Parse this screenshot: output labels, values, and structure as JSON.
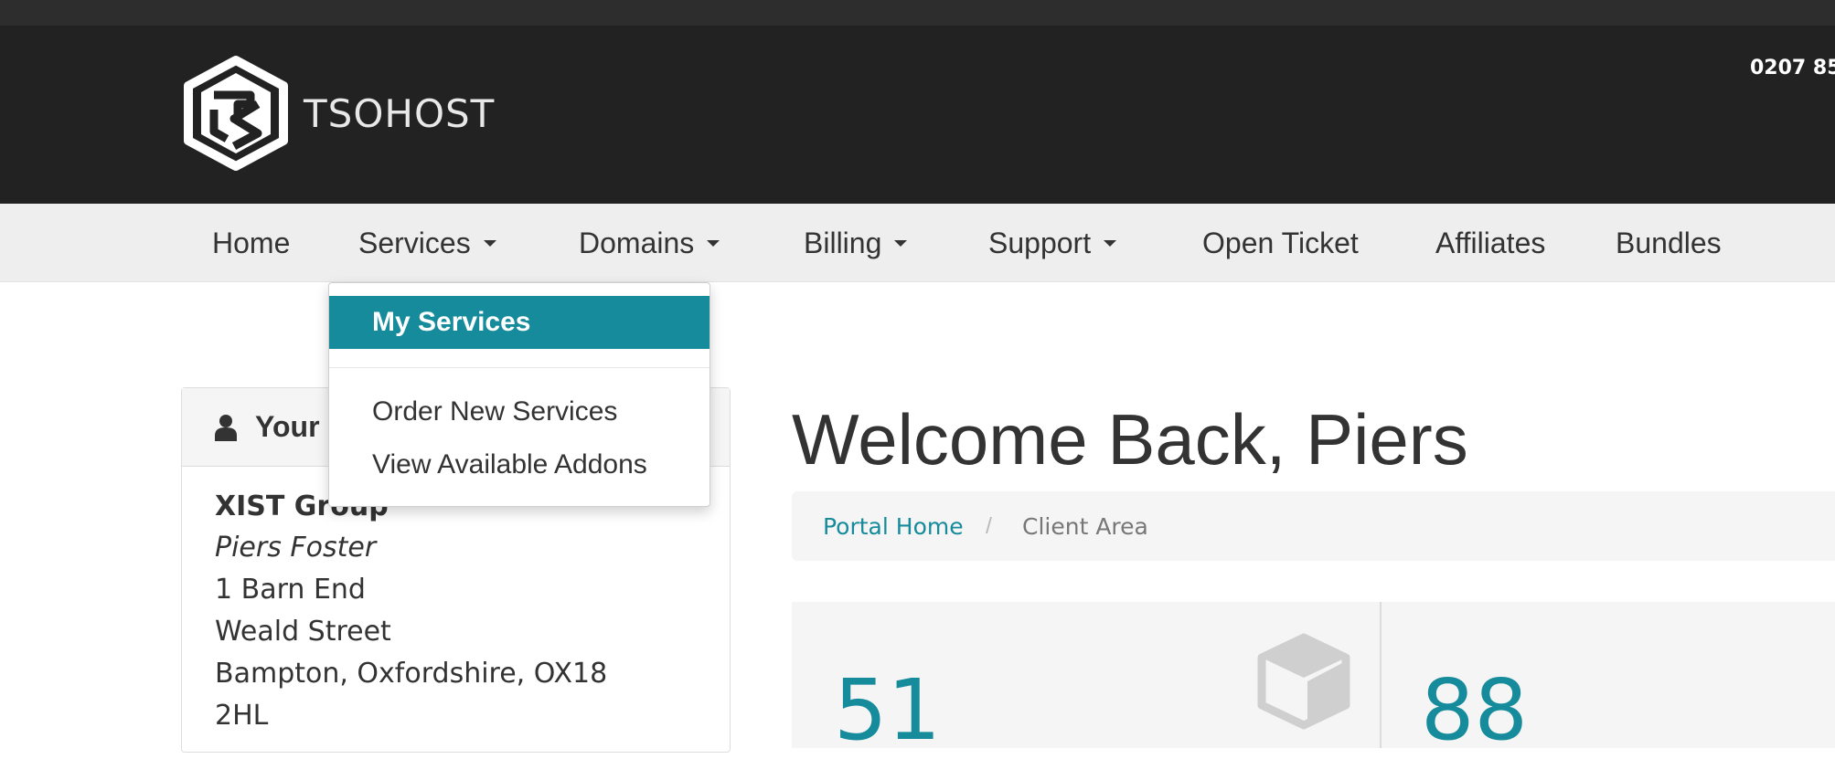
{
  "brand": {
    "name": "TSOHOST",
    "phone": "0207 85"
  },
  "nav": {
    "items": [
      {
        "label": "Home",
        "has_dropdown": false
      },
      {
        "label": "Services",
        "has_dropdown": true
      },
      {
        "label": "Domains",
        "has_dropdown": true
      },
      {
        "label": "Billing",
        "has_dropdown": true
      },
      {
        "label": "Support",
        "has_dropdown": true
      },
      {
        "label": "Open Ticket",
        "has_dropdown": false
      },
      {
        "label": "Affiliates",
        "has_dropdown": false
      },
      {
        "label": "Bundles",
        "has_dropdown": false
      }
    ]
  },
  "services_dropdown": {
    "active": "My Services",
    "items": [
      "Order New Services",
      "View Available Addons"
    ]
  },
  "profile_panel": {
    "title": "Your",
    "company": "XIST Group",
    "name": "Piers Foster",
    "address_lines": [
      "1 Barn End",
      "Weald Street",
      "Bampton, Oxfordshire, OX18",
      "2HL"
    ]
  },
  "main": {
    "welcome": "Welcome Back, Piers",
    "breadcrumb": {
      "home": "Portal Home",
      "separator": "/",
      "current": "Client Area"
    },
    "stats": [
      {
        "value": "51"
      },
      {
        "value": "88"
      }
    ]
  },
  "colors": {
    "accent": "#158b9b",
    "header_bg": "#222222",
    "nav_bg": "#eeeeee"
  },
  "icons": {
    "logo": "tsohost-logo-icon",
    "user": "user-icon",
    "cube": "cube-icon",
    "caret": "caret-down-icon"
  }
}
